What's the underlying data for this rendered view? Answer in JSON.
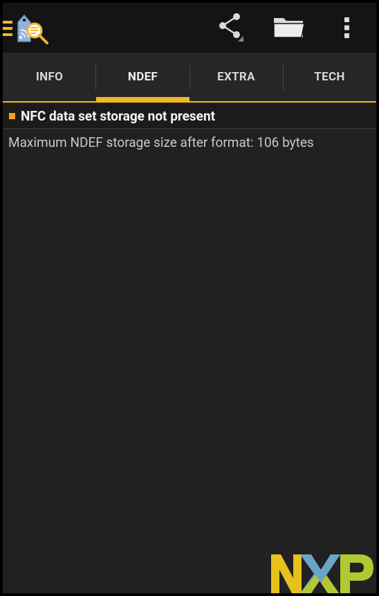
{
  "toolbar": {
    "menu_icon": "hamburger-menu-icon",
    "app_icon": "nfc-tag-search-icon",
    "actions": [
      {
        "name": "share",
        "icon": "share-icon"
      },
      {
        "name": "open-folder",
        "icon": "folder-icon"
      },
      {
        "name": "more",
        "icon": "more-vert-icon"
      }
    ]
  },
  "tabs": [
    {
      "label": "INFO",
      "active": false
    },
    {
      "label": "NDEF",
      "active": true
    },
    {
      "label": "EXTRA",
      "active": false
    },
    {
      "label": "TECH",
      "active": false
    }
  ],
  "content": {
    "section_title": "NFC data set storage not present",
    "info_line": "Maximum NDEF storage size after format: 106 bytes"
  },
  "branding": {
    "logo_icon": "nxp-logo"
  },
  "colors": {
    "accent": "#f2b824",
    "background": "#212121",
    "toolbar": "#141414",
    "tabbar": "#262626",
    "nxp_yellow": "#e8c21a",
    "nxp_blue": "#6ba4c8",
    "nxp_green": "#b2c833"
  }
}
